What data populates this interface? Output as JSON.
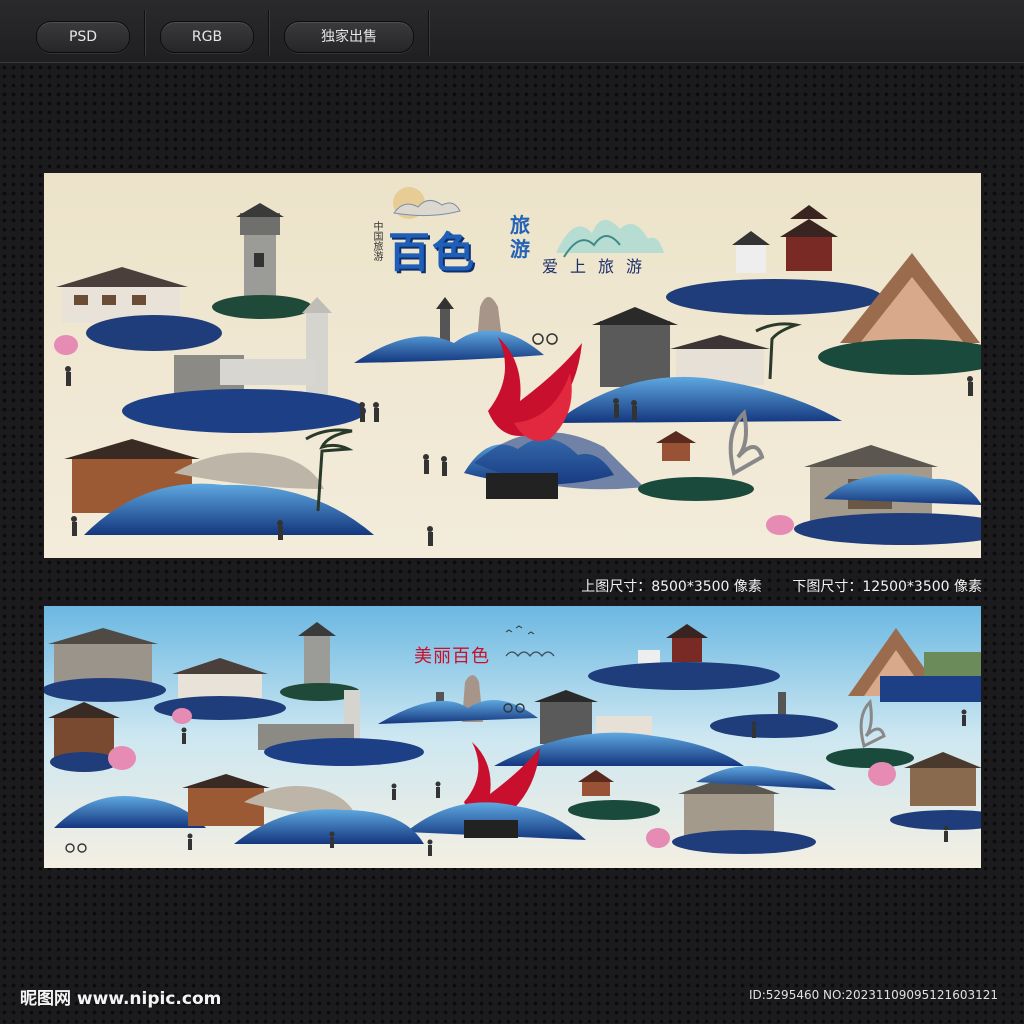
{
  "tags": [
    "PSD",
    "RGB",
    "独家出售"
  ],
  "top_banner": {
    "small_tag": "中国旅游",
    "title": "百色",
    "side": "旅游",
    "slogan": [
      "爱",
      "上",
      "旅",
      "游"
    ]
  },
  "caption": {
    "top_size": "上图尺寸：8500*3500 像素",
    "bottom_size": "下图尺寸：12500*3500 像素"
  },
  "bottom_banner": {
    "title": "美丽百色"
  },
  "footer": {
    "logo": "昵图网 www.nipic.com",
    "id": "ID:5295460 NO:20231109095121603121"
  },
  "colors": {
    "bg": "#1b1b1d",
    "beige": "#f1e8d2",
    "sky": "#7fc2e2",
    "blue": "#2157a8",
    "red": "#c8102e",
    "tree": "#1f3d7a"
  }
}
